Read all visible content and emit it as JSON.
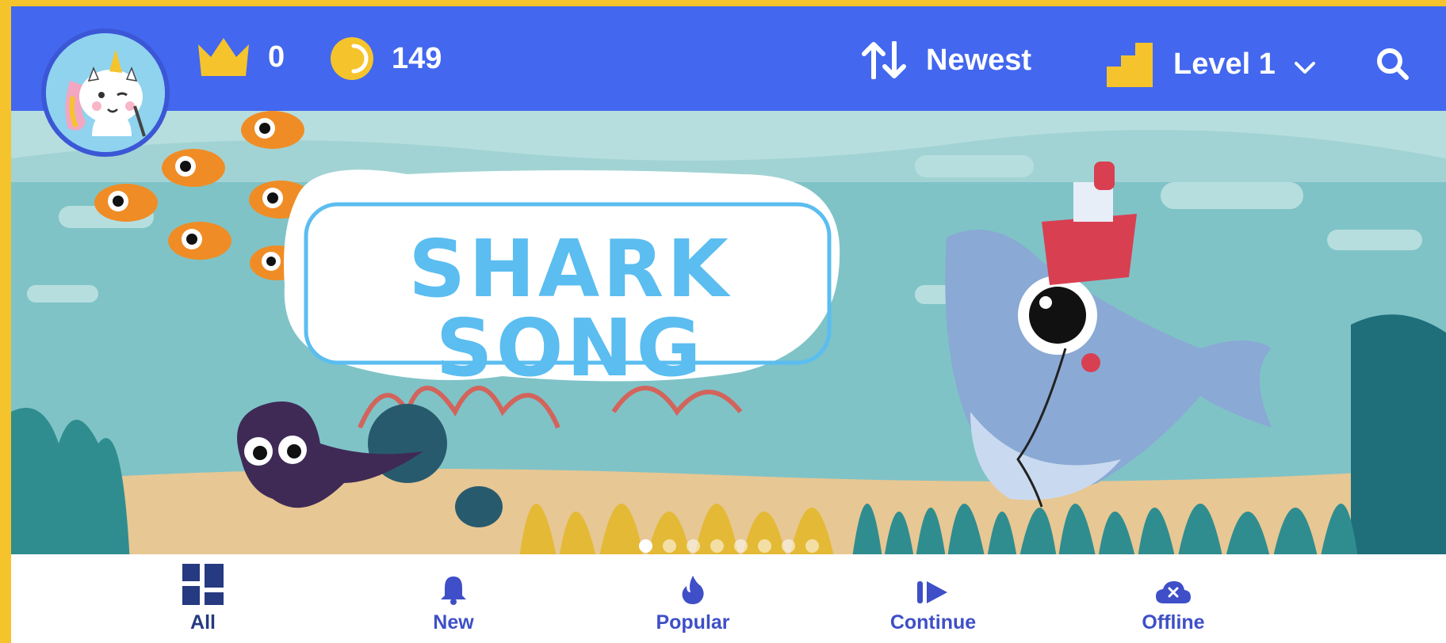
{
  "header": {
    "crowns": "0",
    "coins": "149",
    "sort_label": "Newest",
    "level_label": "Level 1"
  },
  "banner": {
    "title": "SHARK SONG",
    "slide_count": 8,
    "active_slide": 1
  },
  "tabs": [
    {
      "label": "All",
      "icon": "grid-icon",
      "active": true
    },
    {
      "label": "New",
      "icon": "bell-icon",
      "active": false
    },
    {
      "label": "Popular",
      "icon": "flame-icon",
      "active": false
    },
    {
      "label": "Continue",
      "icon": "resume-icon",
      "active": false
    },
    {
      "label": "Offline",
      "icon": "cloud-offline-icon",
      "active": false
    }
  ],
  "colors": {
    "frame": "#f5c42c",
    "header": "#4367ee",
    "tab_active": "#253a80",
    "tab": "#3e4fc7",
    "title_text": "#5bbdf0"
  }
}
